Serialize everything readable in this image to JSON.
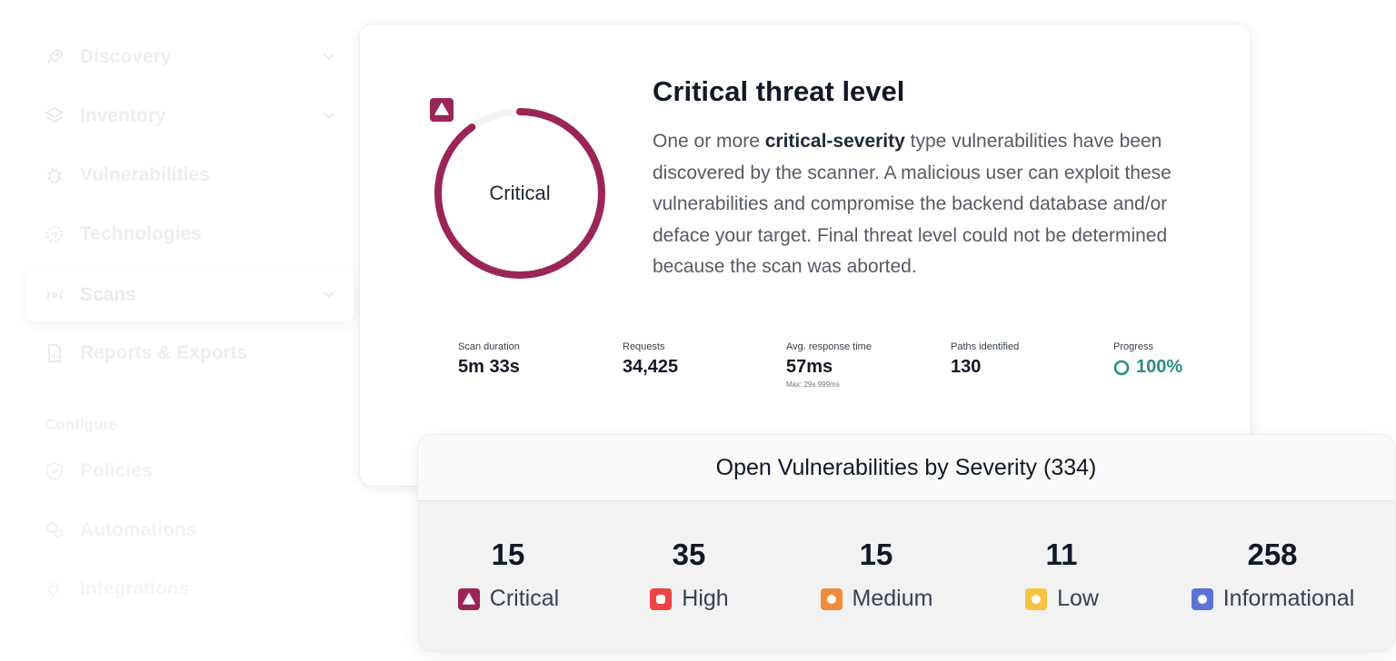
{
  "sidebar": {
    "items": [
      {
        "label": "Discovery",
        "icon": "rocket-icon",
        "chevron": true
      },
      {
        "label": "Inventory",
        "icon": "layers-icon",
        "chevron": true
      },
      {
        "label": "Vulnerabilities",
        "icon": "bug-icon",
        "chevron": false
      },
      {
        "label": "Technologies",
        "icon": "chip-icon",
        "chevron": false
      },
      {
        "label": "Scans",
        "icon": "radar-icon",
        "chevron": true
      },
      {
        "label": "Reports & Exports",
        "icon": "document-icon",
        "chevron": false
      }
    ],
    "configure_label": "Configure",
    "configure_items": [
      {
        "label": "Policies",
        "icon": "shield-icon"
      },
      {
        "label": "Automations",
        "icon": "automation-icon"
      },
      {
        "label": "Integrations",
        "icon": "plug-icon"
      }
    ]
  },
  "threat": {
    "gauge_label": "Critical",
    "gauge_fraction": 0.9,
    "title": "Critical threat level",
    "desc_before": "One or more ",
    "desc_bold": "critical-severity",
    "desc_after": " type vulnerabilities have been discovered by the scanner. A malicious user can exploit these vulnerabilities and compromise the backend database and/or deface your target. Final threat level could not be determined because the scan was aborted."
  },
  "stats": {
    "duration_label": "Scan duration",
    "duration_value": "5m 33s",
    "requests_label": "Requests",
    "requests_value": "34,425",
    "response_label": "Avg. response time",
    "response_value": "57ms",
    "response_sub": "Max: 29s 999ms",
    "paths_label": "Paths identified",
    "paths_value": "130",
    "progress_label": "Progress",
    "progress_value": "100%"
  },
  "vulnerabilities": {
    "title": "Open Vulnerabilities by Severity (334)",
    "items": [
      {
        "count": "15",
        "label": "Critical"
      },
      {
        "count": "35",
        "label": "High"
      },
      {
        "count": "15",
        "label": "Medium"
      },
      {
        "count": "11",
        "label": "Low"
      },
      {
        "count": "258",
        "label": "Informational"
      }
    ]
  },
  "colors": {
    "critical": "#9b2557",
    "high": "#ef4444",
    "medium": "#f28c3b",
    "low": "#f6c343",
    "informational": "#5b72d6",
    "progress": "#2a8f7d"
  }
}
